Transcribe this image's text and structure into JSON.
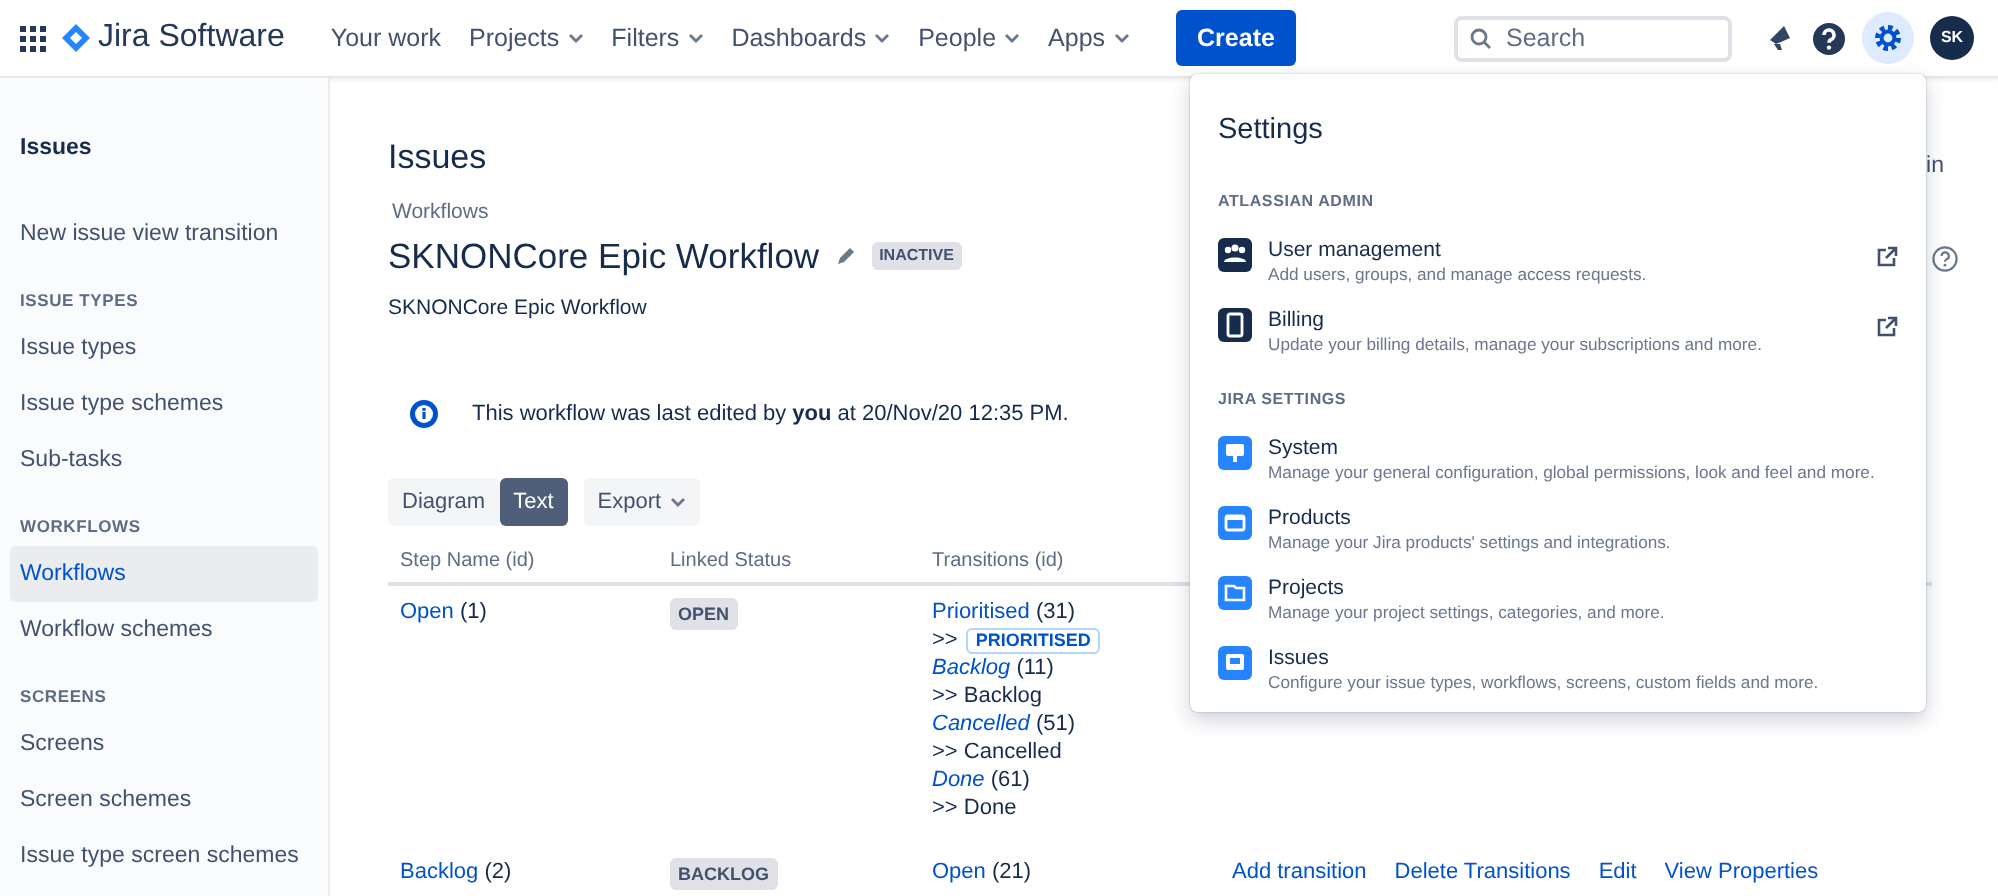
{
  "topnav": {
    "brand": "Jira Software",
    "items": [
      {
        "label": "Your work",
        "dropdown": false
      },
      {
        "label": "Projects",
        "dropdown": true
      },
      {
        "label": "Filters",
        "dropdown": true
      },
      {
        "label": "Dashboards",
        "dropdown": true
      },
      {
        "label": "People",
        "dropdown": true
      },
      {
        "label": "Apps",
        "dropdown": true
      }
    ],
    "create": "Create",
    "search": {
      "placeholder": "Search"
    },
    "settings_open": true,
    "avatar": "SK"
  },
  "sidebar": {
    "title": "Issues",
    "items": [
      {
        "kind": "link",
        "label": "New issue view transition",
        "selected": false
      },
      {
        "kind": "heading",
        "label": "ISSUE TYPES"
      },
      {
        "kind": "link",
        "label": "Issue types",
        "selected": false
      },
      {
        "kind": "link",
        "label": "Issue type schemes",
        "selected": false
      },
      {
        "kind": "link",
        "label": "Sub-tasks",
        "selected": false
      },
      {
        "kind": "heading",
        "label": "WORKFLOWS"
      },
      {
        "kind": "link",
        "label": "Workflows",
        "selected": true
      },
      {
        "kind": "link",
        "label": "Workflow schemes",
        "selected": false
      },
      {
        "kind": "heading",
        "label": "SCREENS"
      },
      {
        "kind": "link",
        "label": "Screens",
        "selected": false
      },
      {
        "kind": "link",
        "label": "Screen schemes",
        "selected": false
      },
      {
        "kind": "link",
        "label": "Issue type screen schemes",
        "selected": false
      }
    ]
  },
  "page": {
    "title": "Issues",
    "breadcrumb": "Workflows",
    "workflow_name": "SKNONCore Epic Workflow",
    "status": "INACTIVE",
    "description": "SKNONCore Epic Workflow",
    "partial_text": "in",
    "notice": "This workflow was last edited by **you** at 20/Nov/20 12:35 PM.",
    "view_tabs": [
      {
        "label": "Diagram",
        "selected": false
      },
      {
        "label": "Text",
        "selected": true
      }
    ],
    "export": "Export"
  },
  "table": {
    "columns": [
      "Step Name (id)",
      "Linked Status",
      "Transitions (id)"
    ],
    "rows": [
      {
        "step": "Open",
        "step_id": "(1)",
        "status": "OPEN",
        "transitions": [
          {
            "name": "Prioritised",
            "id": "(31)",
            "italic": false,
            "prefix": ">>",
            "target": "PRIORITISED",
            "kind": "lozenge"
          },
          {
            "name": "Backlog",
            "id": "(11)",
            "italic": true,
            "prefix": ">>",
            "target": "Backlog",
            "kind": "text"
          },
          {
            "name": "Cancelled",
            "id": "(51)",
            "italic": true,
            "prefix": ">>",
            "target": "Cancelled",
            "kind": "text"
          },
          {
            "name": "Done",
            "id": "(61)",
            "italic": true,
            "prefix": ">>",
            "target": "Done",
            "kind": "text"
          }
        ],
        "actions": []
      },
      {
        "step": "Backlog",
        "step_id": "(2)",
        "status": "BACKLOG",
        "transitions": [
          {
            "name": "Open",
            "id": "(21)",
            "italic": false,
            "kind": "none"
          }
        ],
        "actions": [
          "Add transition",
          "Delete Transitions",
          "Edit",
          "View Properties"
        ]
      }
    ]
  },
  "settings_menu": {
    "title": "Settings",
    "sections": [
      {
        "heading": "ATLASSIAN ADMIN",
        "items": [
          {
            "title": "User management",
            "description": "Add users, groups, and manage access requests.",
            "external": true
          },
          {
            "title": "Billing",
            "description": "Update your billing details, manage your subscriptions and more.",
            "external": true
          }
        ]
      },
      {
        "heading": "JIRA SETTINGS",
        "items": [
          {
            "title": "System",
            "description": "Manage your general configuration, global permissions, look and feel and more.",
            "external": false
          },
          {
            "title": "Products",
            "description": "Manage your Jira products' settings and integrations.",
            "external": false
          },
          {
            "title": "Projects",
            "description": "Manage your project settings, categories, and more.",
            "external": false
          },
          {
            "title": "Issues",
            "description": "Configure your issue types, workflows, screens, custom fields and more.",
            "external": false
          }
        ]
      }
    ]
  }
}
